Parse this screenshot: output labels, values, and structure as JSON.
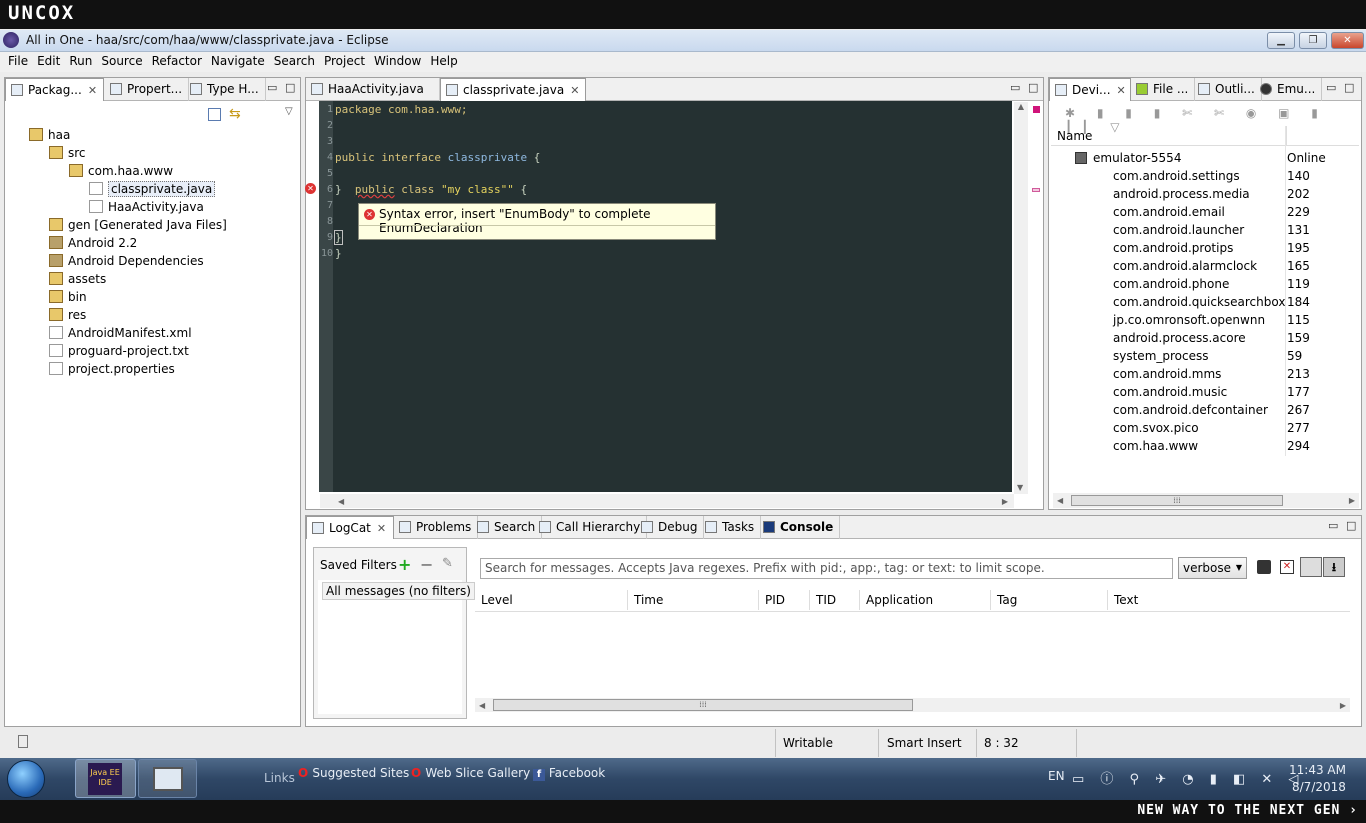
{
  "banner": {
    "logo": "UNCOX",
    "tagline": "NEW WAY TO THE NEXT GEN ›"
  },
  "window": {
    "title": "All in One - haa/src/com/haa/www/classprivate.java - Eclipse",
    "min": "▁",
    "max": "❐",
    "close": "✕"
  },
  "menu": [
    "File",
    "Edit",
    "Run",
    "Source",
    "Refactor",
    "Navigate",
    "Search",
    "Project",
    "Window",
    "Help"
  ],
  "left_tabs": [
    "Packag...",
    "Propert...",
    "Type H..."
  ],
  "tree": {
    "root": "haa",
    "src": "src",
    "pkg": "com.haa.www",
    "file1": "classprivate.java",
    "file2": "HaaActivity.java",
    "gen": "gen [Generated Java Files]",
    "android": "Android 2.2",
    "deps": "Android Dependencies",
    "assets": "assets",
    "bin": "bin",
    "res": "res",
    "manifest": "AndroidManifest.xml",
    "proguard": "proguard-project.txt",
    "props": "project.properties"
  },
  "editor_tabs": [
    "HaaActivity.java",
    "classprivate.java"
  ],
  "code": {
    "l1": "package com.haa.www;",
    "l4a": "public",
    "l4b": "interface",
    "l4c": "classprivate",
    "l4d": " {",
    "l6a": "public",
    "l6b": "class",
    "l6c": "\"my class\"\"",
    "l6d": " {",
    "l9": "}",
    "l10": "}",
    "line_numbers": [
      "1",
      "2",
      "3",
      "4",
      "5",
      "6",
      "7",
      "8",
      "9",
      "10"
    ]
  },
  "tooltip": "Syntax error, insert \"EnumBody\" to complete EnumDeclaration",
  "right_tabs": [
    "Devi...",
    "File ...",
    "Outli...",
    "Emu..."
  ],
  "devices": {
    "col_name": "Name",
    "col_status": "Online",
    "device": "emulator-5554",
    "processes": [
      {
        "name": "com.android.settings",
        "pid": "140"
      },
      {
        "name": "android.process.media",
        "pid": "202"
      },
      {
        "name": "com.android.email",
        "pid": "229"
      },
      {
        "name": "com.android.launcher",
        "pid": "131"
      },
      {
        "name": "com.android.protips",
        "pid": "195"
      },
      {
        "name": "com.android.alarmclock",
        "pid": "165"
      },
      {
        "name": "com.android.phone",
        "pid": "119"
      },
      {
        "name": "com.android.quicksearchbox",
        "pid": "184"
      },
      {
        "name": "jp.co.omronsoft.openwnn",
        "pid": "115"
      },
      {
        "name": "android.process.acore",
        "pid": "159"
      },
      {
        "name": "system_process",
        "pid": "59"
      },
      {
        "name": "com.android.mms",
        "pid": "213"
      },
      {
        "name": "com.android.music",
        "pid": "177"
      },
      {
        "name": "com.android.defcontainer",
        "pid": "267"
      },
      {
        "name": "com.svox.pico",
        "pid": "277"
      },
      {
        "name": "com.haa.www",
        "pid": "294"
      }
    ]
  },
  "bottom_tabs": [
    "LogCat",
    "Problems",
    "Search",
    "Call Hierarchy",
    "Debug",
    "Tasks",
    "Console"
  ],
  "logcat": {
    "saved_filters": "Saved Filters",
    "all_messages": "All messages (no filters)",
    "search_placeholder": "Search for messages. Accepts Java regexes. Prefix with pid:, app:, tag: or text: to limit scope.",
    "level": "verbose",
    "columns": [
      "Level",
      "Time",
      "PID",
      "TID",
      "Application",
      "Tag",
      "Text"
    ]
  },
  "status": {
    "writable": "Writable",
    "insert": "Smart Insert",
    "pos": "8 : 32"
  },
  "taskbar": {
    "links": "Links",
    "l1": "Suggested Sites",
    "l2": "Web Slice Gallery",
    "l3": "Facebook",
    "lang": "EN",
    "time": "11:43 AM",
    "date": "8/7/2018",
    "app1": "Java EE IDE"
  }
}
